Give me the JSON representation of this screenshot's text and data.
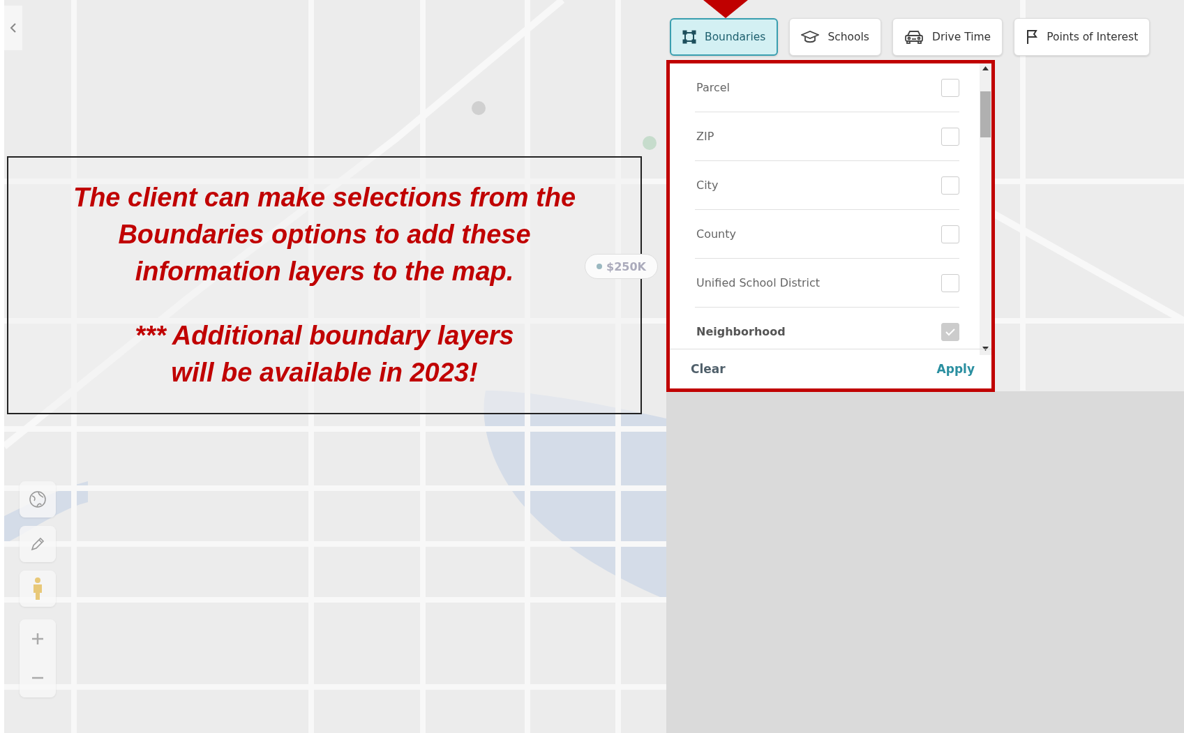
{
  "map": {
    "price_marker": "$250K"
  },
  "annotation": {
    "paragraphs": [
      "The client can make selections from the\nBoundaries options to add these\ninformation layers to the map.",
      "*** Additional boundary layers\nwill be available in 2023!"
    ]
  },
  "tools": [
    {
      "label": "Boundaries",
      "kind": "boundary",
      "selected": true
    },
    {
      "label": "Schools",
      "kind": "school",
      "selected": false
    },
    {
      "label": "Drive Time",
      "kind": "car",
      "selected": false
    },
    {
      "label": "Points of Interest",
      "kind": "flag",
      "selected": false
    }
  ],
  "layer_panel": {
    "items": [
      {
        "label": "Parcel",
        "checked": false
      },
      {
        "label": "ZIP",
        "checked": false
      },
      {
        "label": "City",
        "checked": false
      },
      {
        "label": "County",
        "checked": false
      },
      {
        "label": "Unified School District",
        "checked": false
      },
      {
        "label": "Neighborhood",
        "checked": true
      }
    ],
    "clear": "Clear",
    "apply": "Apply"
  }
}
